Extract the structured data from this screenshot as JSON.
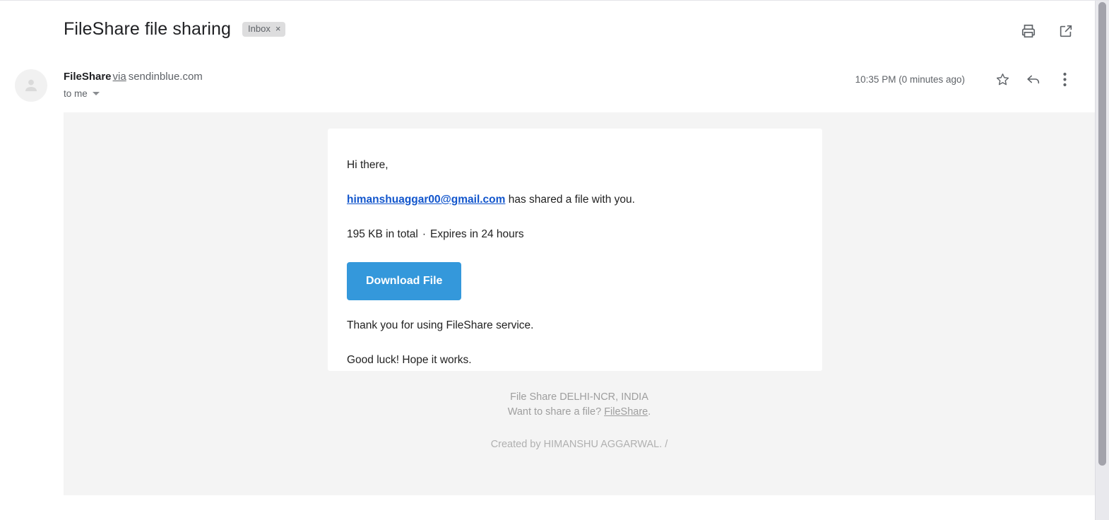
{
  "header": {
    "subject": "FileShare file sharing",
    "label_chip": {
      "text": "Inbox",
      "close": "×"
    },
    "actions": [
      {
        "name": "print-icon",
        "label": "Print"
      },
      {
        "name": "open-in-new-window-icon",
        "label": "Open in new window"
      }
    ]
  },
  "sender": {
    "name": "FileShare",
    "via": "via",
    "domain": "sendinblue.com",
    "recipient": "to me",
    "timestamp": "10:35 PM (0 minutes ago)",
    "avatar_icon": "person-icon",
    "actions": [
      {
        "name": "star-icon",
        "label": "Star"
      },
      {
        "name": "reply-icon",
        "label": "Reply"
      },
      {
        "name": "more-options-icon",
        "label": "More"
      }
    ]
  },
  "message": {
    "greeting": "Hi there,",
    "sharer_email": "himanshuaggar00@gmail.com",
    "shared_text": " has shared a file with you.",
    "size_total": "195 KB in total",
    "separator": "·",
    "expiry": "Expires in 24 hours",
    "download_label": "Download File",
    "thanks": "Thank you for using FileShare service.",
    "goodluck": "Good luck! Hope it works."
  },
  "footer": {
    "org_line": "File Share DELHI-NCR, INDIA",
    "share_prompt": "Want to share a file? ",
    "share_link": "FileShare",
    "share_period": ".",
    "created_by": "Created by HIMANSHU AGGARWAL. /"
  },
  "colors": {
    "accent_button": "#3498db",
    "link": "#1155cc",
    "body_background": "#f4f4f4",
    "card_background": "#ffffff",
    "text_primary": "#202124",
    "text_secondary": "#5f6368",
    "footer_text": "#9e9e9e"
  }
}
